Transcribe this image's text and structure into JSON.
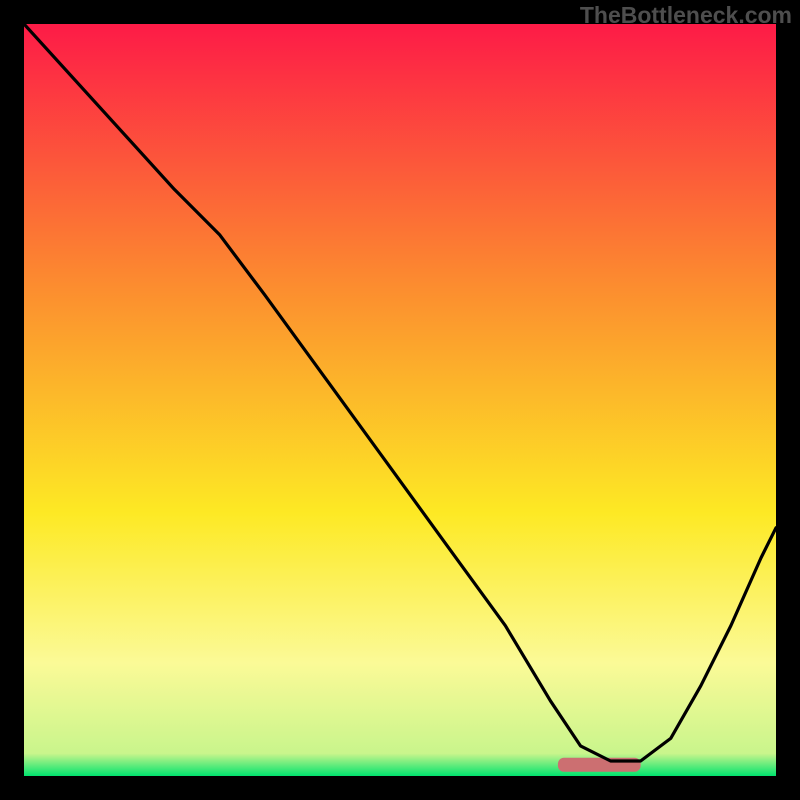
{
  "watermark": "TheBottleneck.com",
  "chart_data": {
    "type": "line",
    "title": "",
    "xlabel": "",
    "ylabel": "",
    "xlim": [
      0,
      100
    ],
    "ylim": [
      0,
      100
    ],
    "grid": false,
    "legend": false,
    "background_gradient": {
      "top_color": "#fd1b47",
      "mid_color_1": "#fc8d2f",
      "mid_color_2": "#fde924",
      "lower_color": "#fbfa97",
      "bottom_color": "#01e36e"
    },
    "marker": {
      "shape": "rounded-bar",
      "color": "#cc6f71",
      "x_start": 71,
      "x_end": 82,
      "y": 1.5
    },
    "series": [
      {
        "name": "curve",
        "color": "#000000",
        "x": [
          0,
          10,
          20,
          26,
          32,
          40,
          48,
          56,
          64,
          70,
          74,
          78,
          82,
          86,
          90,
          94,
          98,
          100
        ],
        "y": [
          100,
          89,
          78,
          72,
          64,
          53,
          42,
          31,
          20,
          10,
          4,
          2,
          2,
          5,
          12,
          20,
          29,
          33
        ]
      }
    ]
  }
}
